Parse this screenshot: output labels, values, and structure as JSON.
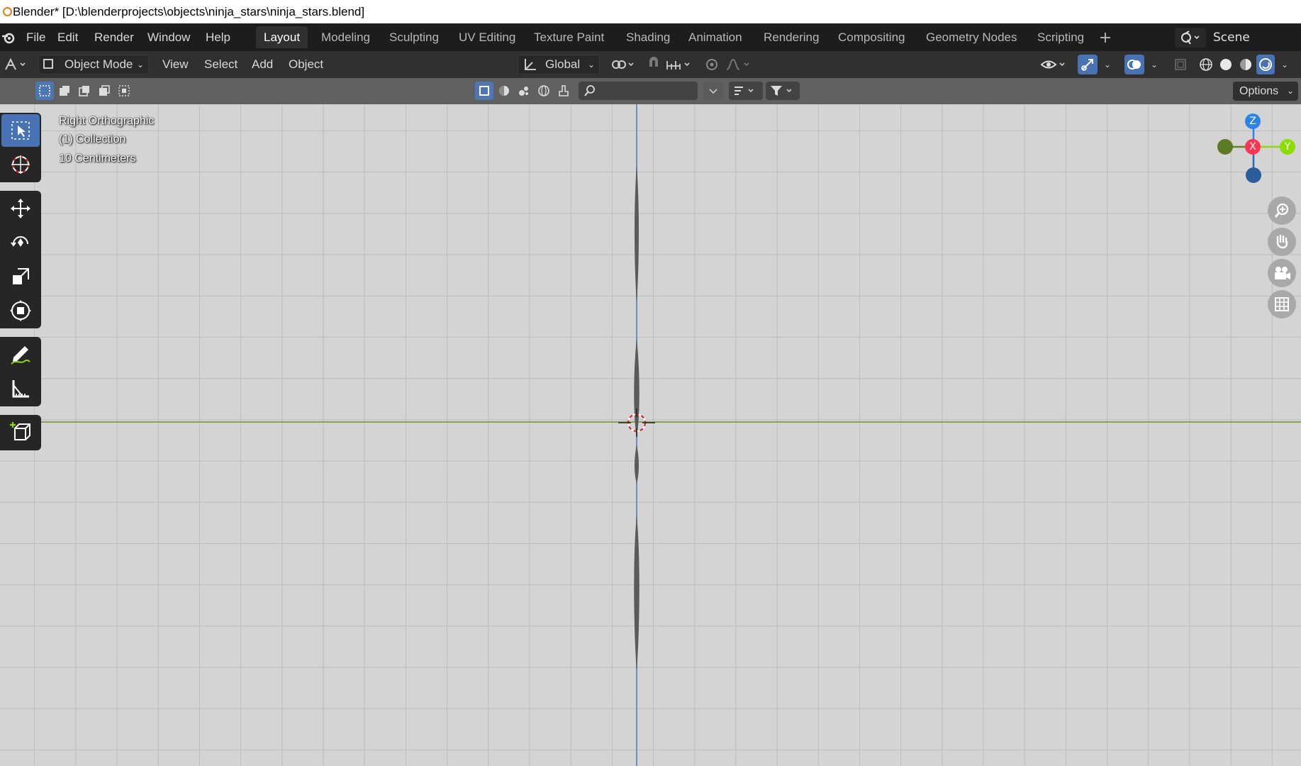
{
  "window": {
    "title": "Blender* [D:\\blenderprojects\\objects\\ninja_stars\\ninja_stars.blend]"
  },
  "menu": {
    "items": [
      "File",
      "Edit",
      "Render",
      "Window",
      "Help"
    ]
  },
  "workspaces": {
    "tabs": [
      "Layout",
      "Modeling",
      "Sculpting",
      "UV Editing",
      "Texture Paint",
      "Shading",
      "Animation",
      "Rendering",
      "Compositing",
      "Geometry Nodes",
      "Scripting"
    ],
    "active": "Layout"
  },
  "scene": {
    "name": "Scene"
  },
  "header": {
    "mode": "Object Mode",
    "menus": [
      "View",
      "Select",
      "Add",
      "Object"
    ],
    "orientation": "Global"
  },
  "toolsettings": {
    "options_label": "Options",
    "search_placeholder": ""
  },
  "viewport": {
    "view_name": "Right Orthographic",
    "collection": "(1) Collection",
    "scale": "10 Centimeters"
  },
  "gizmo": {
    "z": "Z",
    "x": "X",
    "y": "Y"
  },
  "colors": {
    "accent": "#4772b3",
    "x_axis": "#ff3352",
    "y_axis": "#8bdc00",
    "z_axis": "#2b83e8"
  }
}
